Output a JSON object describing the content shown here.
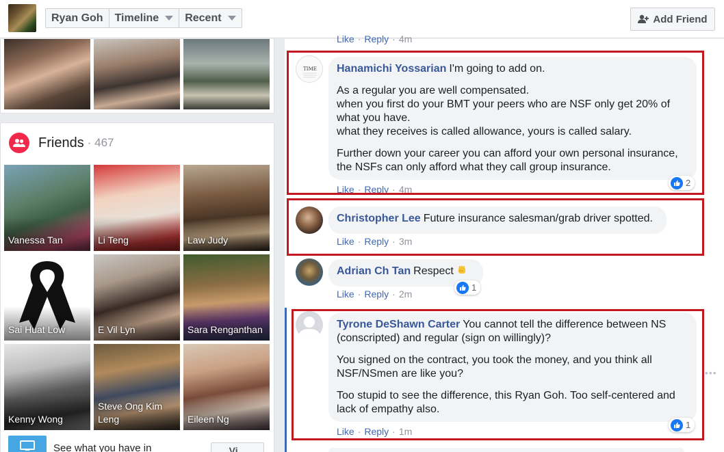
{
  "topbar": {
    "name": "Ryan Goh",
    "timeline": "Timeline",
    "recent": "Recent",
    "add_friend": "Add Friend"
  },
  "friends": {
    "title": "Friends",
    "separator": "·",
    "count": "467",
    "tiles": [
      {
        "name": "Vanessa Tan"
      },
      {
        "name": "Li Teng"
      },
      {
        "name": "Law Judy"
      },
      {
        "name": "Sai Huat Low"
      },
      {
        "name": "E Vil Lyn"
      },
      {
        "name": "Sara Renganthan"
      },
      {
        "name": "Kenny Wong"
      },
      {
        "name": "Steve Ong Kim Leng"
      },
      {
        "name": "Eileen Ng"
      }
    ],
    "see_text": "See what you have in",
    "see_button": "Vi..."
  },
  "top_partial": {
    "like": "Like",
    "reply": "Reply",
    "time": "4m"
  },
  "comments": [
    {
      "author": "Hanamichi Yossarian",
      "paragraphs": [
        "I'm going to add on.",
        "As a regular you are well compensated.\nwhen you first do your BMT your peers who are NSF only get 20% of what you have.\nwhat they receives is called allowance, yours is called salary.",
        "Further down your career you can afford your own personal insurance, the NSFs can only afford what they call group insurance."
      ],
      "like": "Like",
      "reply": "Reply",
      "time": "4m",
      "reactions": "2"
    },
    {
      "author": "Christopher Lee",
      "paragraphs": [
        "Future insurance salesman/grab driver spotted."
      ],
      "like": "Like",
      "reply": "Reply",
      "time": "3m"
    },
    {
      "author": "Adrian Ch Tan",
      "paragraphs": [
        "Respect"
      ],
      "like": "Like",
      "reply": "Reply",
      "time": "2m",
      "reactions": "1"
    },
    {
      "author": "Tyrone DeShawn Carter",
      "paragraphs": [
        "You cannot tell the difference between NS (conscripted) and regular (sign on willingly)?",
        "You signed on the contract, you took the money, and you think all NSF/NSmen are like you?",
        "Too stupid to see the difference, this Ryan Goh. Too self-centered and lack of empathy also."
      ],
      "like": "Like",
      "reply": "Reply",
      "time": "1m",
      "reactions": "1"
    }
  ],
  "colors": {
    "link": "#385898",
    "highlight_box": "#c4171f",
    "like_blue": "#1877f2",
    "friends_icon": "#f02849"
  },
  "icons": {
    "add_friend": "add-friend-icon",
    "friends": "friends-icon",
    "like": "like-icon",
    "emoji": "raised-fist-emoji-icon"
  }
}
